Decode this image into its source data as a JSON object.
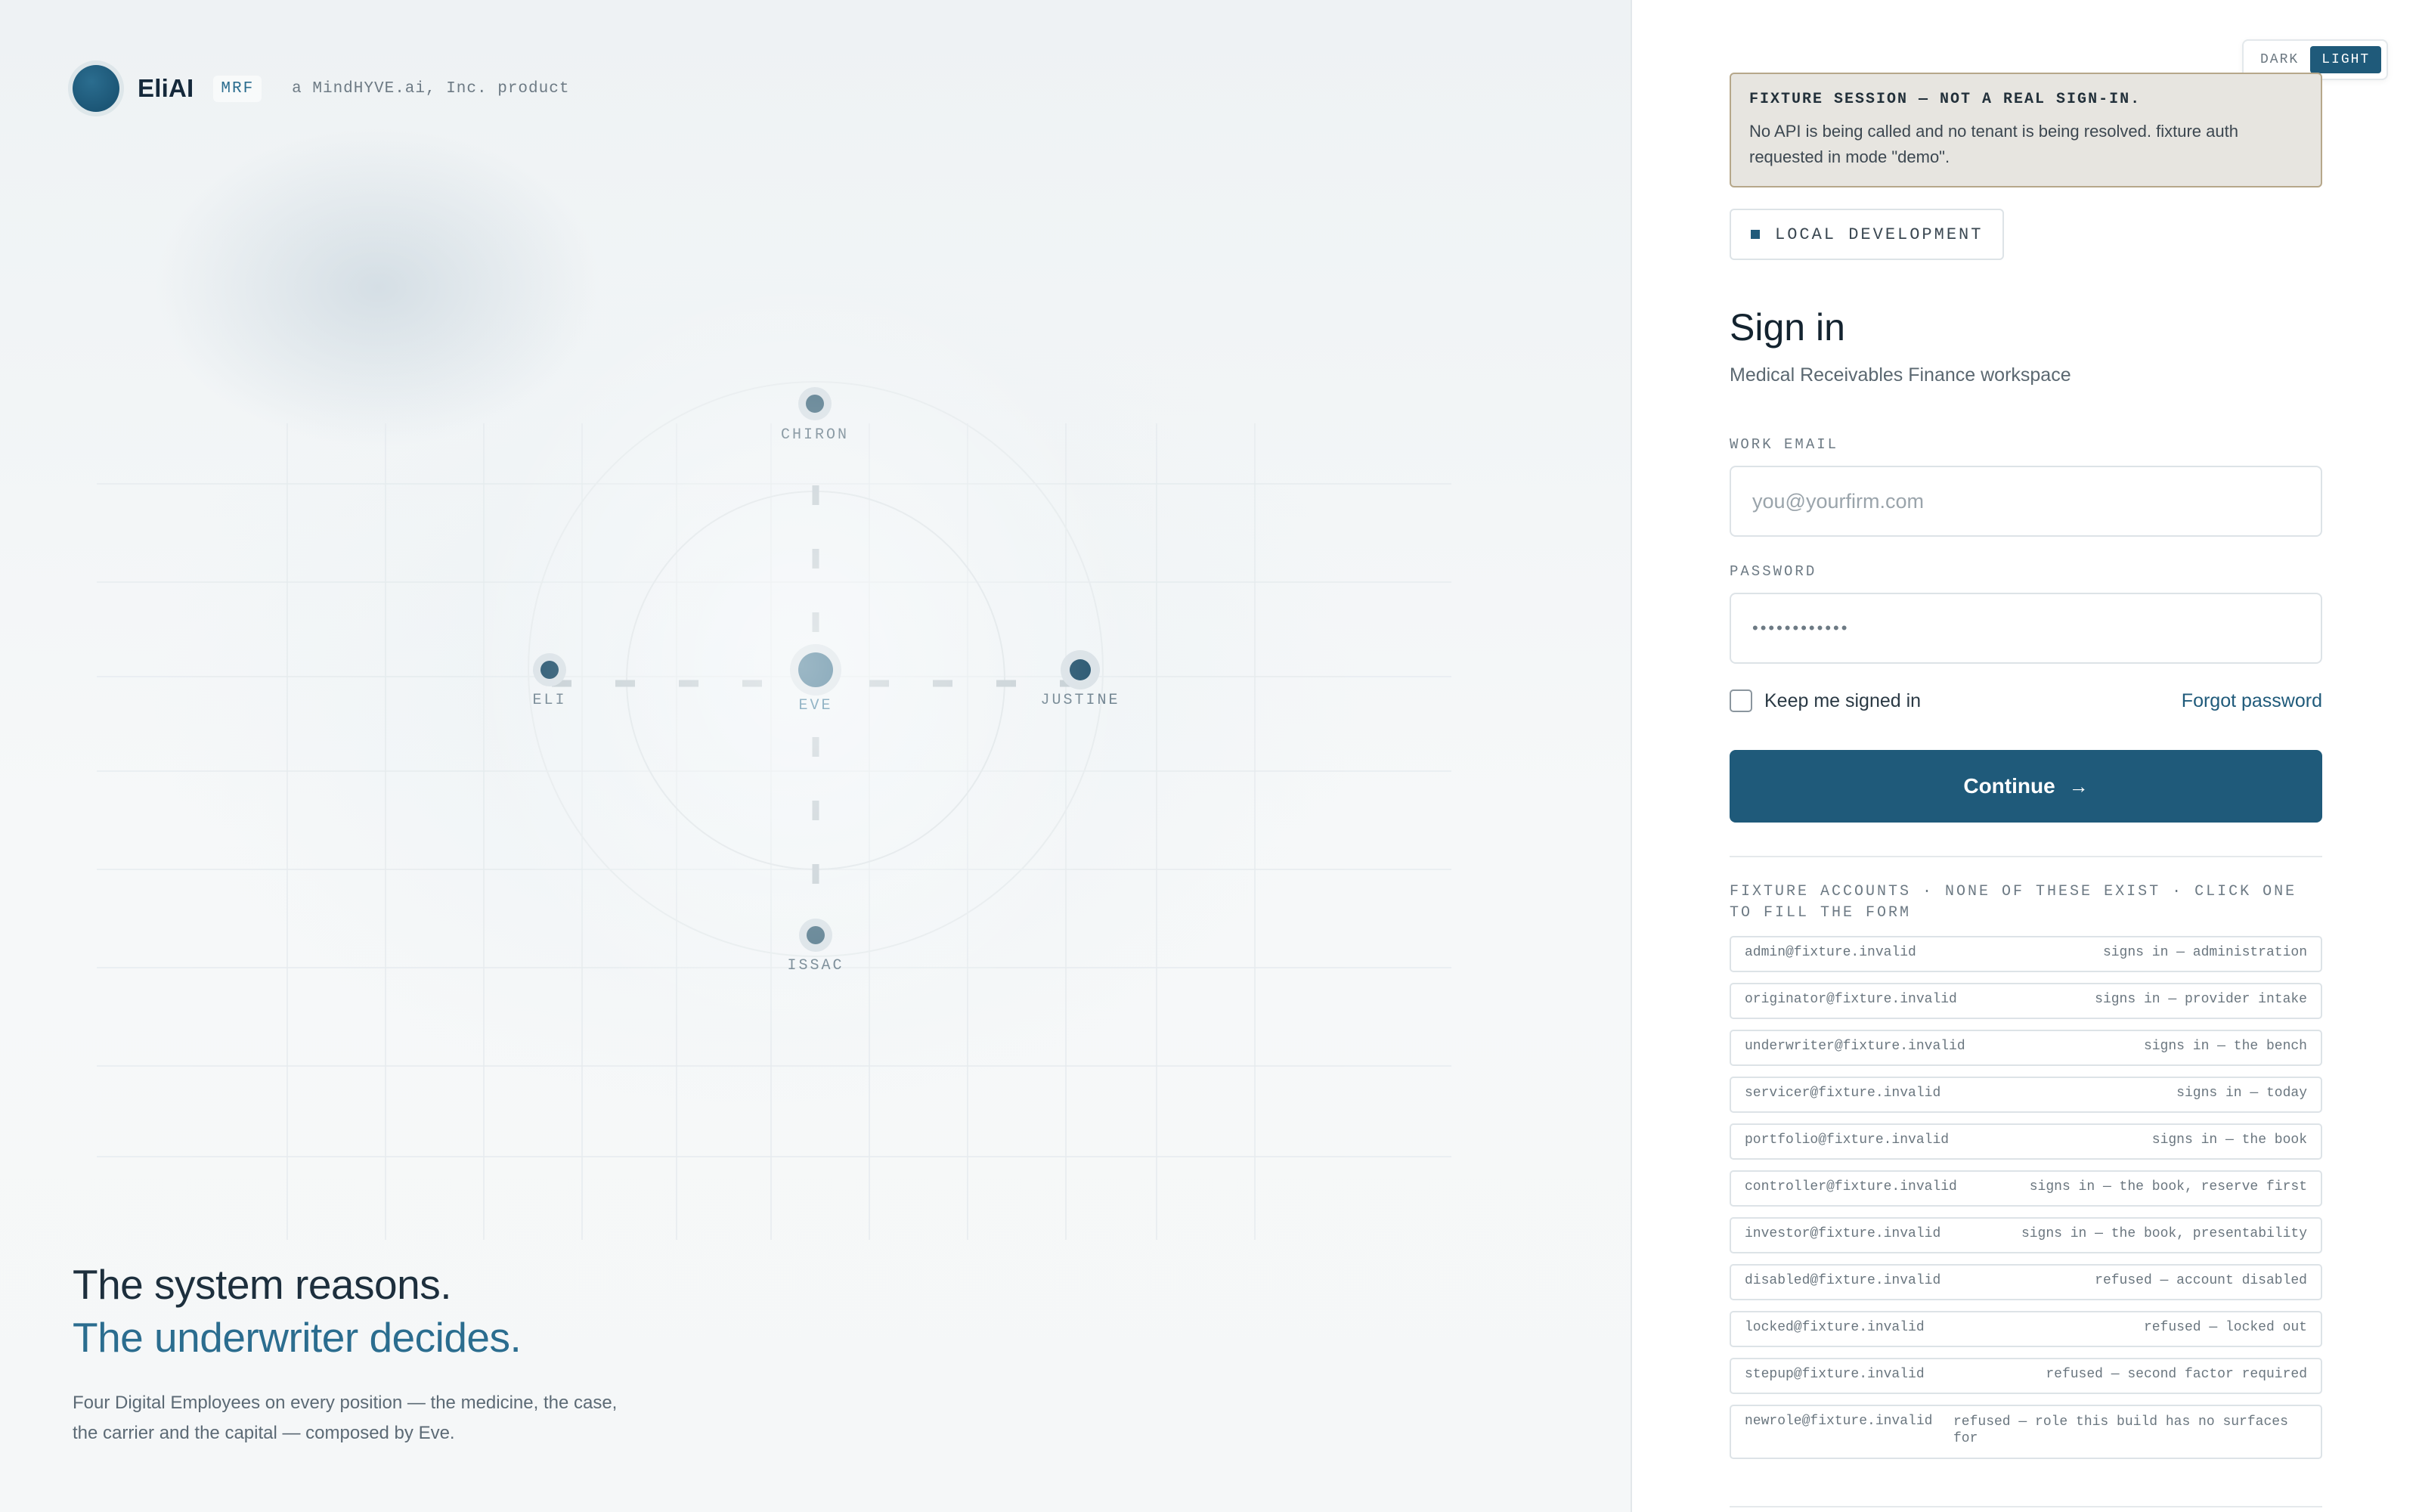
{
  "brand": {
    "name": "EliAI",
    "tag": "MRF",
    "subtitle": "a MindHYVE.ai, Inc. product"
  },
  "diagram": {
    "nodes": {
      "top": "CHIRON",
      "left": "ELI",
      "center": "EVE",
      "right": "JUSTINE",
      "bottom": "ISSAC"
    }
  },
  "hero": {
    "line1": "The system reasons.",
    "line2": "The underwriter decides.",
    "description": "Four Digital Employees on every position — the medicine, the case, the carrier and the capital — composed by Eve."
  },
  "theme": {
    "dark_label": "DARK",
    "light_label": "LIGHT",
    "selected": "LIGHT"
  },
  "fixture_alert": {
    "title": "FIXTURE SESSION — NOT A REAL SIGN-IN.",
    "body": "No API is being called and no tenant is being resolved. fixture auth requested in mode \"demo\"."
  },
  "environment": {
    "label": "LOCAL DEVELOPMENT"
  },
  "signin": {
    "title": "Sign in",
    "subtitle": "Medical Receivables Finance workspace",
    "email_label": "WORK EMAIL",
    "email_placeholder": "you@yourfirm.com",
    "email_value": "",
    "password_label": "PASSWORD",
    "password_value": "••••••••••••",
    "remember_label": "Keep me signed in",
    "remember_checked": false,
    "forgot_label": "Forgot password",
    "continue_label": "Continue",
    "continue_arrow": "→"
  },
  "fixture_accounts": {
    "heading": "FIXTURE ACCOUNTS · NONE OF THESE EXIST · CLICK ONE TO FILL THE FORM",
    "items": [
      {
        "email": "admin@fixture.invalid",
        "description": "signs in — administration"
      },
      {
        "email": "originator@fixture.invalid",
        "description": "signs in — provider intake"
      },
      {
        "email": "underwriter@fixture.invalid",
        "description": "signs in — the bench"
      },
      {
        "email": "servicer@fixture.invalid",
        "description": "signs in — today"
      },
      {
        "email": "portfolio@fixture.invalid",
        "description": "signs in — the book"
      },
      {
        "email": "controller@fixture.invalid",
        "description": "signs in — the book, reserve first"
      },
      {
        "email": "investor@fixture.invalid",
        "description": "signs in — the book, presentability"
      },
      {
        "email": "disabled@fixture.invalid",
        "description": "refused — account disabled"
      },
      {
        "email": "locked@fixture.invalid",
        "description": "refused — locked out"
      },
      {
        "email": "stepup@fixture.invalid",
        "description": "refused — second factor required"
      },
      {
        "email": "newrole@fixture.invalid",
        "description": "refused — role this build has no surfaces for"
      }
    ]
  },
  "colors": {
    "accent": "#1f5a7a",
    "alert_bg": "#e7e5e0",
    "alert_border": "#b6a78a"
  }
}
